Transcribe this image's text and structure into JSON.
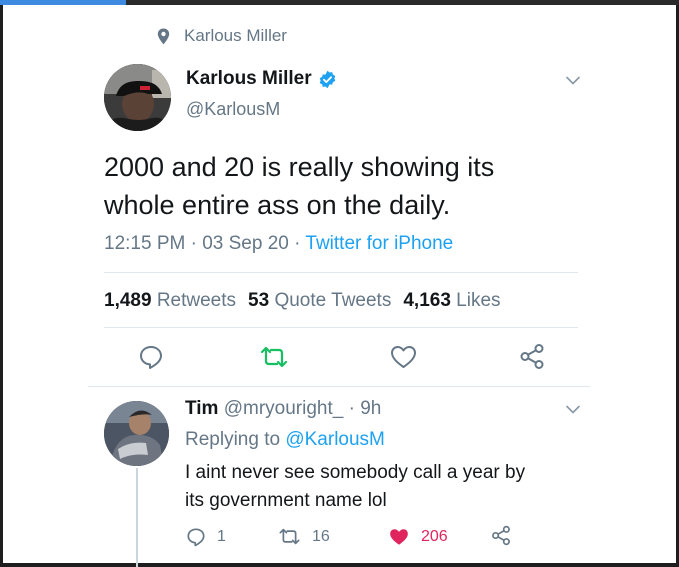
{
  "context": {
    "label": "Karlous Miller",
    "icon": "location-pin-icon"
  },
  "tweet": {
    "display_name": "Karlous Miller",
    "verified": true,
    "handle": "@KarlousM",
    "text_line1": "2000 and 20 is really showing its",
    "text_line2": "whole entire ass on the daily.",
    "time": "12:15 PM",
    "date": "03 Sep 20",
    "separator": " · ",
    "source": "Twitter for iPhone",
    "stats": {
      "retweets_count": "1,489",
      "retweets_label": "Retweets",
      "quote_count": "53",
      "quote_label": "Quote Tweets",
      "likes_count": "4,163",
      "likes_label": "Likes"
    }
  },
  "reply": {
    "display_name": "Tim",
    "handle": "@mryouright_",
    "separator": " · ",
    "time": "9h",
    "replying_label": "Replying to ",
    "replying_to": "@KarlousM",
    "text_line1": "I aint never see somebody call a year by",
    "text_line2": "its government name lol",
    "reply_count": "1",
    "retweet_count": "16",
    "like_count": "206"
  },
  "colors": {
    "accent": "#1da1f2",
    "retweet": "#17bf63",
    "like": "#e0245e",
    "muted": "#657786",
    "text": "#14171a"
  }
}
